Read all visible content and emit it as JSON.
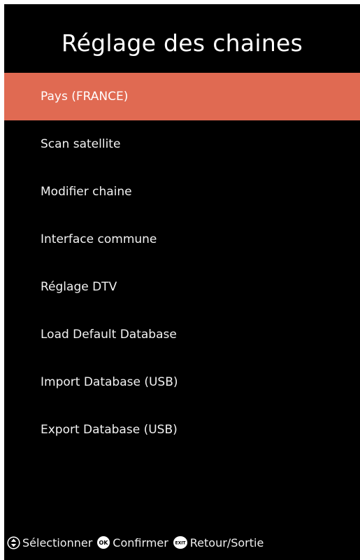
{
  "title": "Réglage des chaines",
  "menu": {
    "items": [
      {
        "label": "Pays (FRANCE)",
        "selected": true
      },
      {
        "label": "Scan satellite",
        "selected": false
      },
      {
        "label": "Modifier chaine",
        "selected": false
      },
      {
        "label": "Interface commune",
        "selected": false
      },
      {
        "label": "Réglage DTV",
        "selected": false
      },
      {
        "label": "Load Default Database",
        "selected": false
      },
      {
        "label": "Import Database (USB)",
        "selected": false
      },
      {
        "label": "Export Database (USB)",
        "selected": false
      }
    ]
  },
  "footer": {
    "select": {
      "icon": "up-down-icon",
      "label": "Sélectionner"
    },
    "confirm": {
      "icon": "ok-button-icon",
      "icon_text": "OK",
      "label": "Confirmer"
    },
    "exit": {
      "icon": "exit-button-icon",
      "icon_text": "EXIT",
      "label": "Retour/Sortie"
    }
  },
  "colors": {
    "background": "#000000",
    "highlight": "#e06a52",
    "text": "#ffffff"
  }
}
